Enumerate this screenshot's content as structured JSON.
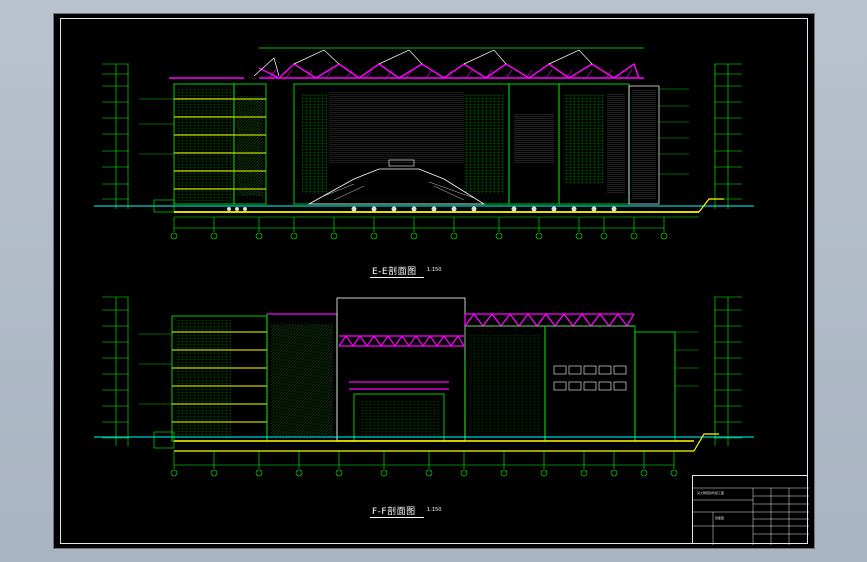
{
  "sections": [
    {
      "title": "E-E剖面图",
      "scale": "1:150"
    },
    {
      "title": "F-F剖面图",
      "scale": "1:150"
    }
  ],
  "colors": {
    "background": "#000000",
    "green": "#00ff00",
    "yellow": "#ffff00",
    "magenta": "#ff00ff",
    "white": "#ffffff",
    "cyan": "#00ffff"
  },
  "title_block": {
    "project": "某大剧院建筑施工图",
    "drawing": "剖面图"
  }
}
